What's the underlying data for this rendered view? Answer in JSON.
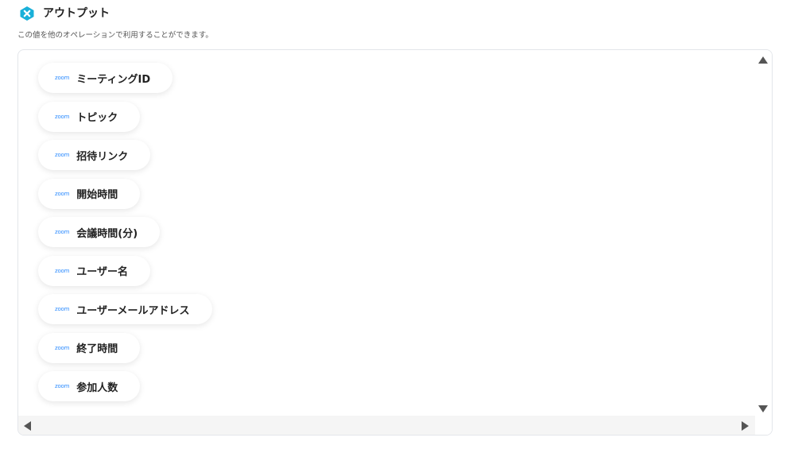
{
  "header": {
    "title": "アウトプット",
    "logo_icon": "yoom-logo-icon",
    "logo_color": "#1ab0d9"
  },
  "subtitle": "この値を他のオペレーションで利用することができます。",
  "outputs": [
    {
      "source": "zoom",
      "label": "ミーティングID"
    },
    {
      "source": "zoom",
      "label": "トピック"
    },
    {
      "source": "zoom",
      "label": "招待リンク"
    },
    {
      "source": "zoom",
      "label": "開始時間"
    },
    {
      "source": "zoom",
      "label": "会議時間(分)"
    },
    {
      "source": "zoom",
      "label": "ユーザー名"
    },
    {
      "source": "zoom",
      "label": "ユーザーメールアドレス"
    },
    {
      "source": "zoom",
      "label": "終了時間"
    },
    {
      "source": "zoom",
      "label": "参加人数"
    }
  ],
  "colors": {
    "zoom_brand": "#2D8CFF",
    "panel_border": "#e3e6ea"
  }
}
